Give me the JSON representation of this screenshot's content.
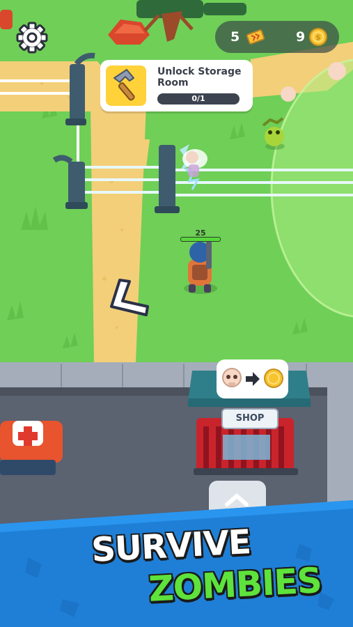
{
  "hud": {
    "tickets": "5",
    "coins": "9",
    "ticket_icon": "ticket-icon",
    "coin_icon": "gold-coin-icon",
    "settings_icon": "gear-icon"
  },
  "objective": {
    "title": "Unlock Storage Room",
    "progress_text": "0/1",
    "progress_fraction": 0,
    "icon": "hammer-icon"
  },
  "player": {
    "hp": "25",
    "hp_fraction": 1.0
  },
  "shop": {
    "sign": "SHOP",
    "exchange_from_icon": "skull-icon",
    "exchange_arrow_icon": "arrow-right-icon",
    "exchange_to_icon": "gold-coin-icon"
  },
  "promo": {
    "line1": "SURVIVE",
    "line2": "ZOMBIES"
  },
  "colors": {
    "grass": "#6fcf57",
    "path": "#f3cf79",
    "coin": "#f6c431",
    "objective_yellow": "#ffd23a",
    "banner_blue": "#1f7fd6",
    "zombies_green": "#5ee23c"
  }
}
